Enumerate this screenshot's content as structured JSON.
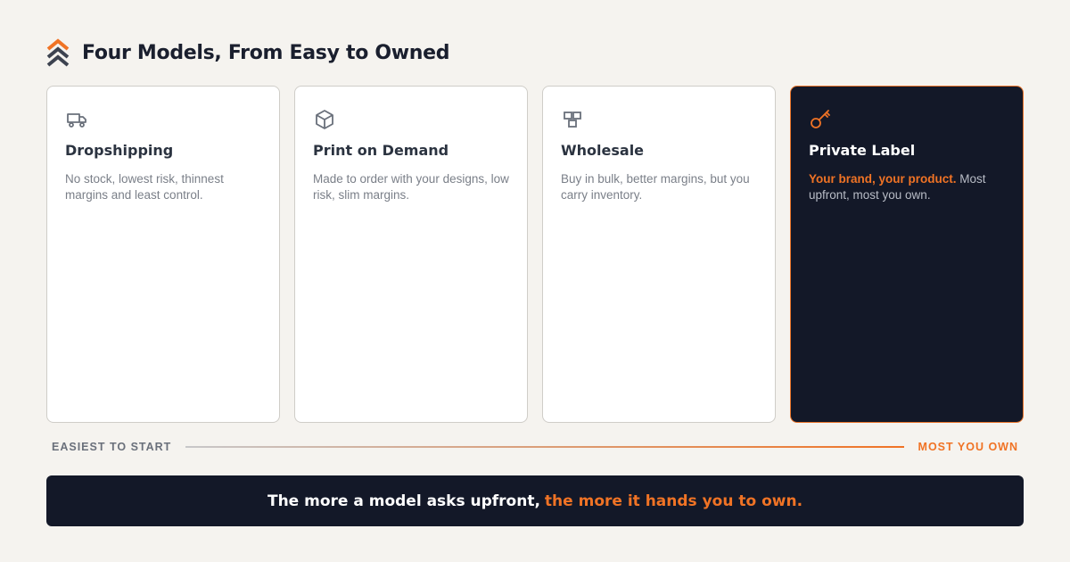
{
  "header": {
    "title": "Four Models, From Easy to Owned",
    "logo_icon": "double-chevron-up-icon"
  },
  "colors": {
    "accent": "#f07325",
    "dark": "#131828",
    "background": "#f5f3ef"
  },
  "cards": [
    {
      "title": "Dropshipping",
      "icon": "truck-icon",
      "description": "No stock, lowest risk, thinnest margins and least control."
    },
    {
      "title": "Print on Demand",
      "icon": "box-icon",
      "description": "Made to order with your designs, low risk, slim margins."
    },
    {
      "title": "Wholesale",
      "icon": "stacked-boxes-icon",
      "description": "Buy in bulk, better margins, but you carry inventory."
    },
    {
      "title": "Private Label",
      "icon": "key-icon",
      "highlight": "Your brand, your product.",
      "description": "Most upfront, most you own."
    }
  ],
  "scale": {
    "start_label": "EASIEST TO START",
    "end_label": "MOST YOU OWN"
  },
  "banner": {
    "text": "The more a model asks upfront,",
    "accent_text": "the more it hands you to own."
  }
}
